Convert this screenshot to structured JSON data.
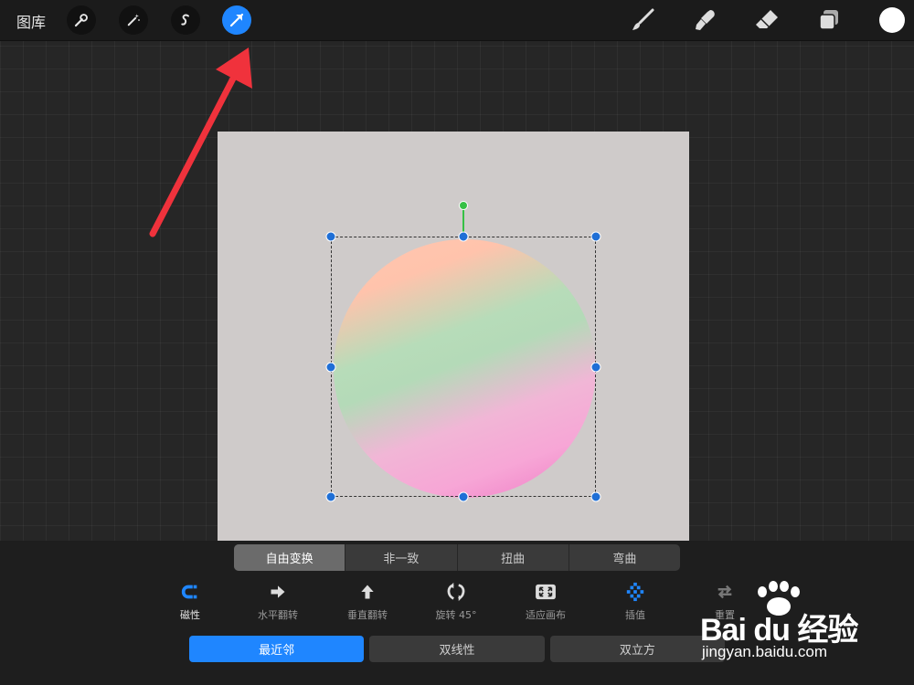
{
  "toolbar": {
    "gallery_label": "图库",
    "left_tools": [
      {
        "name": "wrench-icon",
        "label": "actions"
      },
      {
        "name": "magic-wand-icon",
        "label": "adjustments"
      },
      {
        "name": "selection-s-icon",
        "label": "selection"
      },
      {
        "name": "transform-arrow-icon",
        "label": "transform",
        "active": true
      }
    ],
    "right_tools": [
      "brush-icon",
      "smudge-icon",
      "eraser-icon",
      "layers-icon"
    ],
    "current_color": "#ffffff"
  },
  "transform": {
    "modes": [
      "自由变换",
      "非一致",
      "扭曲",
      "弯曲"
    ],
    "active_mode": "自由变换",
    "tools": [
      {
        "icon": "magnet-icon",
        "label": "磁性",
        "active": true
      },
      {
        "icon": "flip-horizontal-icon",
        "label": "水平翻转"
      },
      {
        "icon": "flip-vertical-icon",
        "label": "垂直翻转"
      },
      {
        "icon": "rotate-icon",
        "label": "旋转 45°"
      },
      {
        "icon": "fit-canvas-icon",
        "label": "适应画布"
      },
      {
        "icon": "interpolation-icon",
        "label": "插值"
      },
      {
        "icon": "reset-icon",
        "label": "重置"
      }
    ],
    "interpolation": [
      "最近邻",
      "双线性",
      "双立方"
    ],
    "active_interpolation": "最近邻"
  },
  "watermark": {
    "logo": "Bai du 经验",
    "url": "jingyan.baidu.com"
  },
  "colors": {
    "accent": "#1f86ff",
    "rotate_handle": "#36c045",
    "canvas": "#cfcbca"
  }
}
